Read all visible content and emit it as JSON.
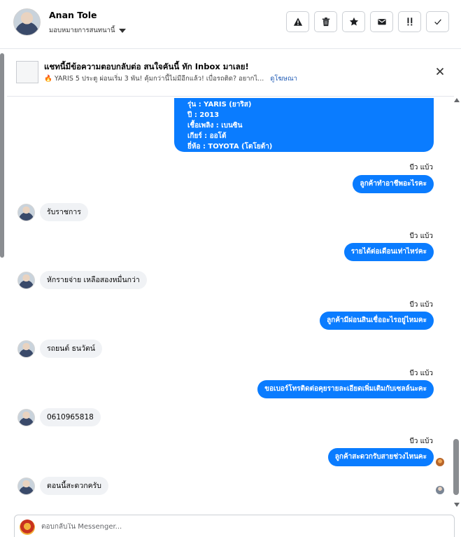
{
  "header": {
    "contact_name": "Anan Tole",
    "assign_label": "มอบหมายการสนทนานี้",
    "actions": [
      {
        "name": "report-button",
        "icon": "warning-icon"
      },
      {
        "name": "delete-button",
        "icon": "trash-icon"
      },
      {
        "name": "star-button",
        "icon": "star-icon"
      },
      {
        "name": "mark-unread-button",
        "icon": "envelope-icon"
      },
      {
        "name": "follow-up-button",
        "icon": "priority-icon"
      },
      {
        "name": "mark-done-button",
        "icon": "check-icon"
      }
    ]
  },
  "banner": {
    "title": "แชทนี้มีข้อความตอบกลับต่อ สนใจคันนี้ ทัก Inbox มาเลย!",
    "subtitle": "🔥 YARIS 5 ประตู ผ่อนเริ่ม 3 พัน! คุ้มกว่านี้ไม่มีอีกแล้ว! เบื่อรถติด? อยากไ...",
    "link": "ดูโฆษณา"
  },
  "card": {
    "lines": [
      "รุ่น : YARIS (ยาริส)",
      "ปี : 2013",
      "เชื้อเพลิง : เบนซิน",
      "เกียร์ : ออโต้",
      "ยี่ห้อ : TOYOTA (โตโยต้า)"
    ]
  },
  "messages": [
    {
      "sender": "บีว แบ้ว",
      "text": "ลูกค้าทำอาชีพอะไรคะ"
    },
    {
      "text": "รับราชการ"
    },
    {
      "sender": "บีว แบ้ว",
      "text": "รายได้ต่อเดือนเท่าไหร่คะ"
    },
    {
      "text": "หักรายจ่าย เหลือสองหมื่นกว่า"
    },
    {
      "sender": "บีว แบ้ว",
      "text": "ลูกค้ามีผ่อนสินเชื่ออะไรอยู่ไหมคะ"
    },
    {
      "text": "รถยนต์ ธนวัตน์"
    },
    {
      "sender": "บีว แบ้ว",
      "text": "ขอเบอร์โทรติดต่อคุยรายละเอียดเพิ่มเติมกับเซลล์นะคะ"
    },
    {
      "text": "0610965818"
    },
    {
      "sender": "บีว แบ้ว",
      "text": "ลูกค้าสะดวกรับสายช่วงไหนคะ"
    },
    {
      "text": "ตอนนี้สะดวกครับ"
    }
  ],
  "composer": {
    "placeholder": "ตอบกลับใน Messenger..."
  },
  "colors": {
    "accent": "#0a7cff",
    "incoming_bubble": "#f0f2f5"
  }
}
